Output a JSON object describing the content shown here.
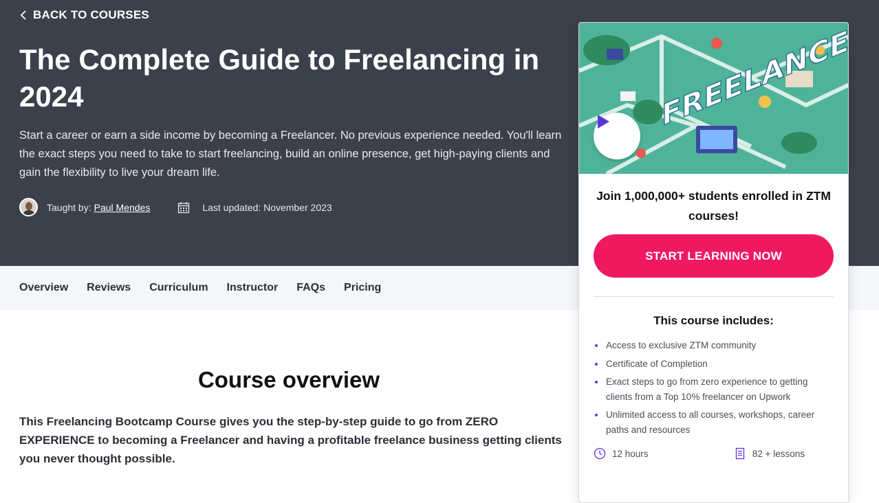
{
  "header": {
    "back_label": "BACK TO COURSES",
    "title": "The Complete Guide to Freelancing in 2024",
    "subtitle": "Start a career or earn a side income by becoming a Freelancer. No previous experience needed. You'll learn the exact steps you need to take to start freelancing, build an online presence, get high-paying clients and gain the flexibility to live your dream life.",
    "taught_by_label": "Taught by:",
    "author": "Paul Mendes",
    "last_updated": "Last updated: November 2023"
  },
  "nav": {
    "items": [
      "Overview",
      "Reviews",
      "Curriculum",
      "Instructor",
      "FAQs",
      "Pricing"
    ]
  },
  "overview": {
    "title": "Course overview",
    "text": "This Freelancing Bootcamp Course gives you the step-by-step guide to go from ZERO EXPERIENCE to becoming a Freelancer and having a profitable freelance business getting clients you never thought possible."
  },
  "card": {
    "thumbnail_word": "FREELANCE",
    "enroll_text": "Join 1,000,000+ students enrolled in ZTM courses!",
    "cta_label": "START LEARNING NOW",
    "includes_title": "This course includes:",
    "includes": [
      "Access to exclusive ZTM community",
      "Certificate of Completion",
      "Exact steps to go from zero experience to getting clients from a Top 10% freelancer on Upwork",
      "Unlimited access to all courses, workshops, career paths and resources"
    ],
    "duration": "12 hours",
    "lessons": "82 + lessons"
  },
  "colors": {
    "hero_bg": "#3c404b",
    "cta": "#f0195f",
    "accent": "#5b34d8",
    "thumb_bg": "#4fb39a"
  },
  "icons": [
    "chevron-left-icon",
    "calendar-icon",
    "play-icon",
    "clock-icon",
    "document-icon"
  ]
}
